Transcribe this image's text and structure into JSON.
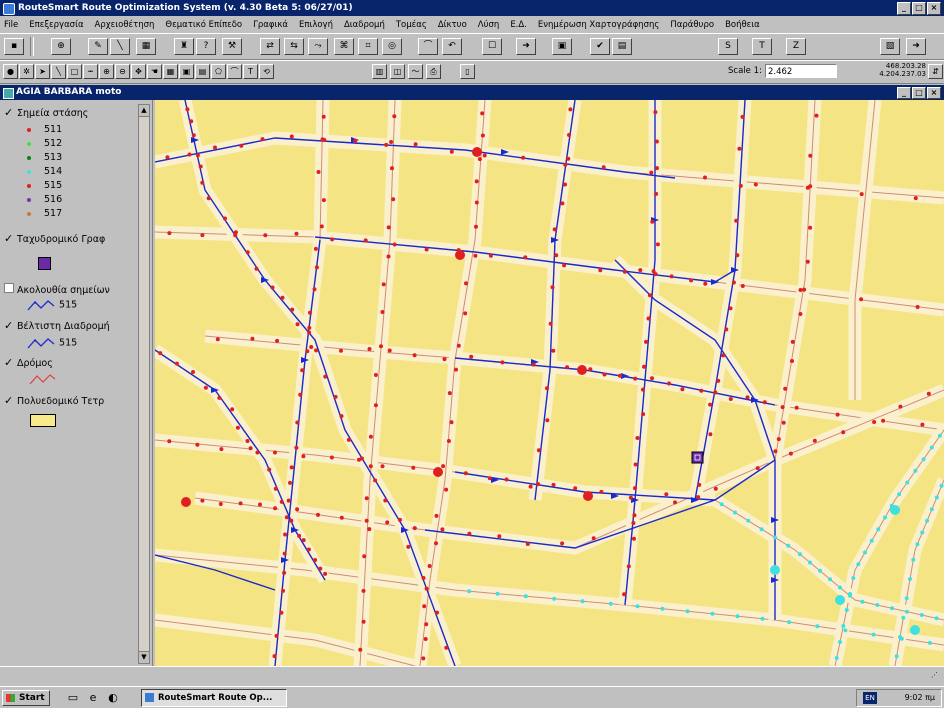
{
  "app": {
    "title": "RouteSmart Route Optimization System (v. 4.30 Beta 5: 06/27/01)",
    "window_buttons": [
      "_",
      "□",
      "×"
    ]
  },
  "menu": [
    "File",
    "Επεξεργασία",
    "Αρχειοθέτηση",
    "Θεματικό Επίπεδο",
    "Γραφικά",
    "Επιλογή",
    "Διαδρομή",
    "Τομέας",
    "Δίκτυο",
    "Λύση",
    "Ε.Δ.",
    "Ενημέρωση Χαρτογράφησης",
    "Παράθυρο",
    "Βοήθεια"
  ],
  "toolbar": {
    "scale_label": "Scale 1:",
    "scale_value": "2.462",
    "coord_1": "468.203.28",
    "coord_2": "4.204.237.03",
    "letter_buttons": [
      "S",
      "T",
      "Z"
    ]
  },
  "document": {
    "title": "AGIA BARBARA moto"
  },
  "legend": {
    "group1_title": "Σημεία στάσης",
    "stops": [
      {
        "label": "511",
        "color": "#e02020"
      },
      {
        "label": "512",
        "color": "#40e040"
      },
      {
        "label": "513",
        "color": "#108010"
      },
      {
        "label": "514",
        "color": "#40e0e0"
      },
      {
        "label": "515",
        "color": "#e02020"
      },
      {
        "label": "516",
        "color": "#8030a0"
      },
      {
        "label": "517",
        "color": "#c08030"
      }
    ],
    "group2_title": "Ταχυδρομικό Γραφ",
    "group3_title": "Ακολουθία σημείων",
    "group3_item": "515",
    "group4_title": "Βέλτιστη Διαδρομή",
    "group4_item": "515",
    "group5_title": "Δρόμος",
    "group6_title": "Πολυεδομικό Τετρ"
  },
  "taskbar": {
    "start_label": "Start",
    "task_label": "RouteSmart Route Op...",
    "lang": "EN",
    "clock": "9:02 πμ"
  },
  "colors": {
    "map_bg": "#f4e484",
    "road_fill": "#fbf0cc",
    "road_line": "#d08a7a",
    "route_blue": "#1a2ad0",
    "stop_red": "#e02020",
    "stop_cyan": "#40e0e0",
    "depot": "#6a2aa8"
  }
}
